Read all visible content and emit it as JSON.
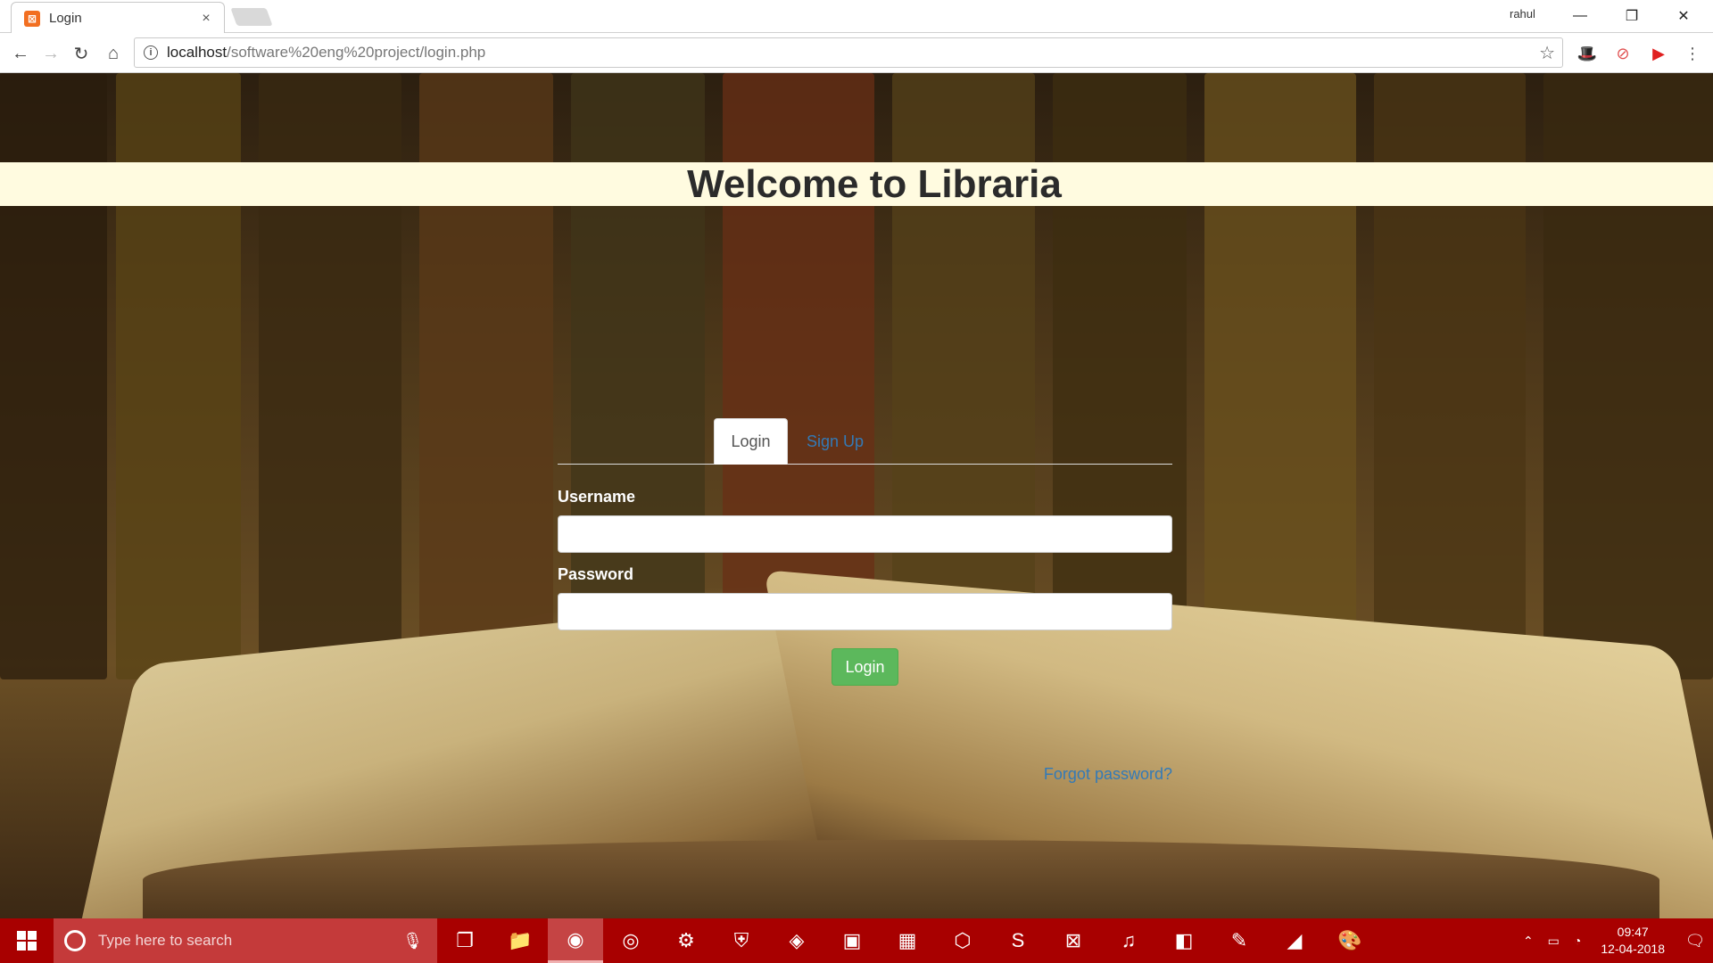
{
  "browser": {
    "tab_title": "Login",
    "tab_close": "×",
    "profile_name": "rahul",
    "url_host": "localhost",
    "url_path": "/software%20eng%20project/login.php"
  },
  "page": {
    "welcome_title": "Welcome to Libraria",
    "tabs": {
      "login": "Login",
      "signup": "Sign Up"
    },
    "username_label": "Username",
    "password_label": "Password",
    "username_value": "",
    "password_value": "",
    "login_button": "Login",
    "forgot_link": "Forgot password?"
  },
  "taskbar": {
    "search_placeholder": "Type here to search",
    "time": "09:47",
    "date": "12-04-2018"
  },
  "colors": {
    "taskbar": "#a80000",
    "welcome_bar": "#fffbe0",
    "login_button": "#5cb85c",
    "link": "#337ab7"
  }
}
